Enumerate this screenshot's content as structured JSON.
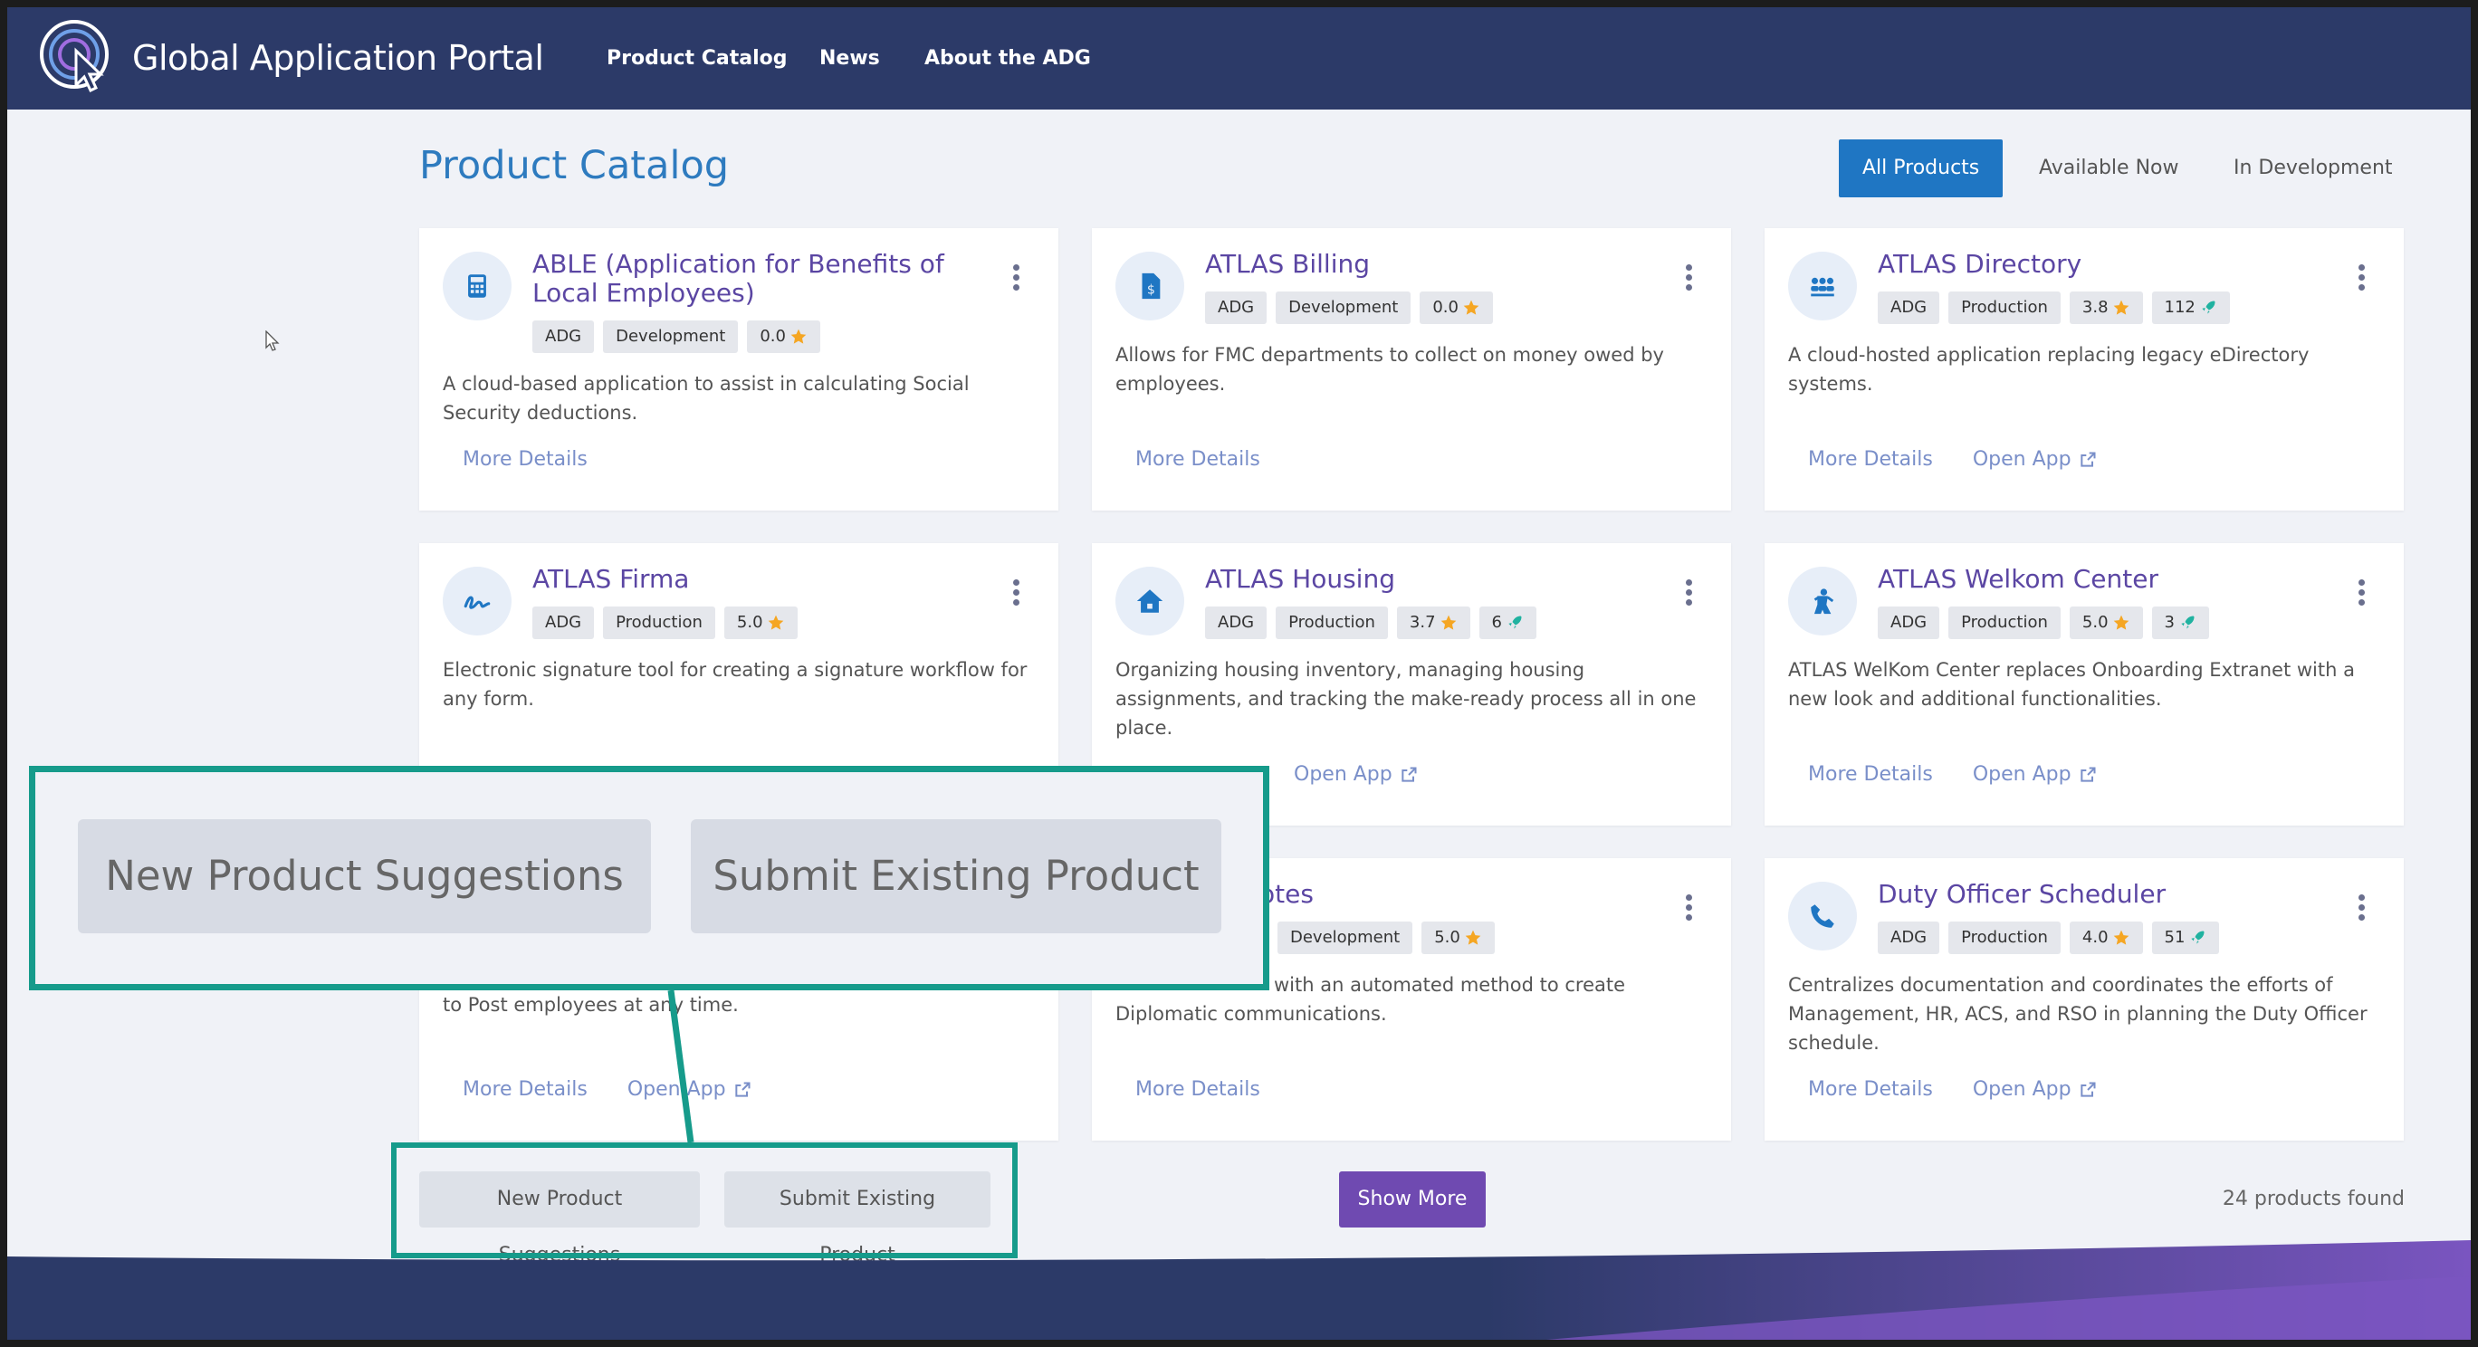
{
  "app": {
    "title": "Global Application Portal"
  },
  "nav": {
    "items": [
      "Product Catalog",
      "News",
      "About the ADG"
    ]
  },
  "page": {
    "title": "Product Catalog"
  },
  "filters": {
    "all": "All Products",
    "available": "Available Now",
    "dev": "In Development",
    "active": "All Products"
  },
  "cards": [
    {
      "title": "ABLE (Application for Benefits of Local Employees)",
      "icon": "calculator-icon",
      "badges": [
        "ADG",
        "Development",
        "0.0"
      ],
      "description": "A cloud-based application to assist in calculating Social Security deductions.",
      "links": [
        "More Details"
      ]
    },
    {
      "title": "ATLAS Billing",
      "icon": "invoice-icon",
      "badges": [
        "ADG",
        "Development",
        "0.0"
      ],
      "description": "Allows for FMC departments to collect on money owed by employees.",
      "links": [
        "More Details"
      ]
    },
    {
      "title": "ATLAS Directory",
      "icon": "people-group-icon",
      "badges": [
        "ADG",
        "Production",
        "3.8",
        "112"
      ],
      "description": "A cloud-hosted application replacing legacy eDirectory systems.",
      "links": [
        "More Details",
        "Open App"
      ]
    },
    {
      "title": "ATLAS Firma",
      "icon": "signature-icon",
      "badges": [
        "ADG",
        "Production",
        "5.0"
      ],
      "description": "Electronic signature tool for creating a signature workflow for any form.",
      "links": []
    },
    {
      "title": "ATLAS Housing",
      "icon": "house-icon",
      "badges": [
        "ADG",
        "Production",
        "3.7",
        "6"
      ],
      "description": "Organizing housing inventory, managing housing assignments, and tracking the make-ready process all in one place.",
      "links": [
        "Open App"
      ]
    },
    {
      "title": "ATLAS Welkom Center",
      "icon": "person-icon",
      "badges": [
        "ADG",
        "Production",
        "5.0",
        "3"
      ],
      "description": "ATLAS WelKom Center replaces Onboarding Extranet with a new look and additional functionalities.",
      "links": [
        "More Details",
        "Open App"
      ]
    },
    {
      "title": "",
      "icon": "",
      "badges": [],
      "description": "to Post employees at any time.",
      "links": [
        "More Details",
        "Open App"
      ]
    },
    {
      "title": "otes",
      "icon": "",
      "badges": [
        "Development",
        "5.0"
      ],
      "description": "with an automated method to create Diplomatic communications.",
      "links": [
        "More Details"
      ]
    },
    {
      "title": "Duty Officer Scheduler",
      "icon": "phone-icon",
      "badges": [
        "ADG",
        "Production",
        "4.0",
        "51"
      ],
      "description": "Centralizes documentation and coordinates the efforts of Management, HR, ACS, and RSO in planning the Duty Officer schedule.",
      "links": [
        "More Details",
        "Open App"
      ]
    }
  ],
  "actions": {
    "suggest": "New Product Suggestions",
    "submit": "Submit Existing Product",
    "show_more": "Show More",
    "found": "24 products found"
  },
  "colors": {
    "navbar": "#2c3a68",
    "accent": "#1f76c3",
    "title": "#5b46a3",
    "highlight": "#169b8b",
    "show_more": "#6f4ab1"
  }
}
